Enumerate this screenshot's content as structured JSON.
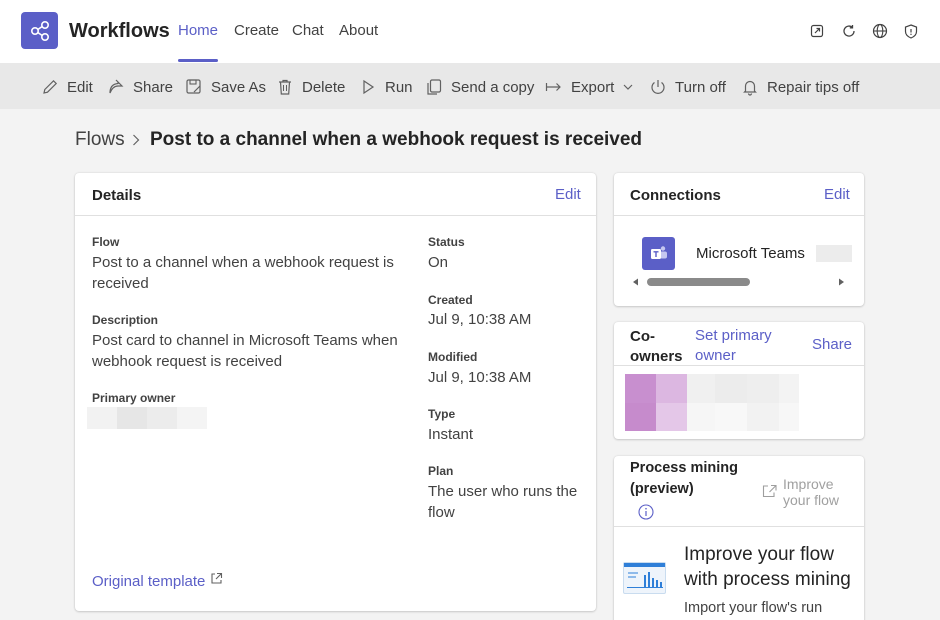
{
  "app": {
    "title": "Workflows",
    "accent": "#5b5fc7",
    "logo_icon": "workflow-icon"
  },
  "nav": {
    "tabs": [
      {
        "label": "Home",
        "active": true
      },
      {
        "label": "Create",
        "active": false
      },
      {
        "label": "Chat",
        "active": false
      },
      {
        "label": "About",
        "active": false
      }
    ],
    "right_icons": [
      "popout-icon",
      "refresh-icon",
      "globe-icon",
      "shield-icon"
    ]
  },
  "toolbar": {
    "items": [
      {
        "label": "Edit",
        "icon": "pencil-icon"
      },
      {
        "label": "Share",
        "icon": "share-icon"
      },
      {
        "label": "Save As",
        "icon": "save-as-icon"
      },
      {
        "label": "Delete",
        "icon": "trash-icon"
      },
      {
        "label": "Run",
        "icon": "play-icon"
      },
      {
        "label": "Send a copy",
        "icon": "copy-icon"
      },
      {
        "label": "Export",
        "icon": "export-icon"
      },
      {
        "label": "Turn off",
        "icon": "power-icon"
      },
      {
        "label": "Repair tips off",
        "icon": "bell-icon"
      }
    ]
  },
  "breadcrumb": {
    "root": "Flows",
    "current": "Post to a channel when a webhook request is received"
  },
  "details": {
    "title": "Details",
    "edit_label": "Edit",
    "flow_label": "Flow",
    "flow_value_line1": "Post to a channel when a webhook request is",
    "flow_value_line2": "received",
    "description_label": "Description",
    "description_value_line1": "Post card to channel in Microsoft Teams when",
    "description_value_line2": "webhook request is received",
    "primary_owner_label": "Primary owner",
    "status_label": "Status",
    "status_value": "On",
    "created_label": "Created",
    "created_value": "Jul 9, 10:38 AM",
    "modified_label": "Modified",
    "modified_value": "Jul 9, 10:38 AM",
    "type_label": "Type",
    "type_value": "Instant",
    "plan_label": "Plan",
    "plan_value_line1": "The user who runs the",
    "plan_value_line2": "flow",
    "template_link": "Original template"
  },
  "connections": {
    "title": "Connections",
    "edit_label": "Edit",
    "item_name": "Microsoft Teams",
    "item_icon": "teams-icon"
  },
  "coowners": {
    "title_line1": "Co-",
    "title_line2": "owners",
    "set_primary_line1": "Set primary",
    "set_primary_line2": "owner",
    "share_label": "Share"
  },
  "process_mining": {
    "title_line1": "Process mining",
    "title_line2": "(preview)",
    "improve_line1": "Improve",
    "improve_line2": "your flow",
    "heading_line1": "Improve your flow",
    "heading_line2": "with process mining",
    "body_text": "Import your flow's run"
  }
}
